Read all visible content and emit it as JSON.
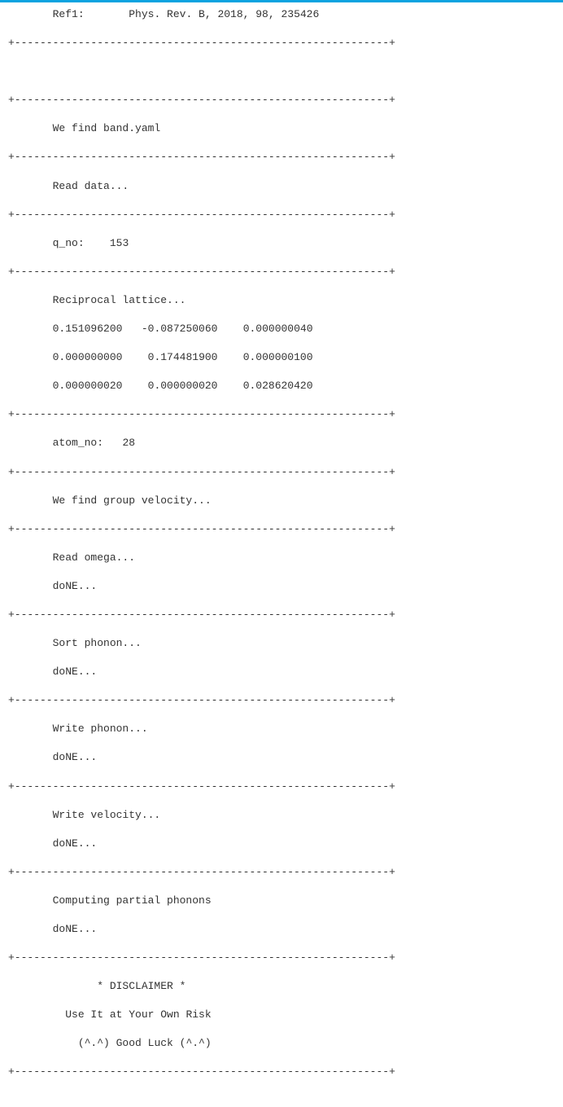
{
  "ref": {
    "label": "Ref1:",
    "citation": "Phys. Rev. B, 2018, 98, 235426"
  },
  "divider": "+-----------------------------------------------------------+",
  "sections": {
    "find_band": "We find band.yaml",
    "read_data": "Read data...",
    "q_no_label": "q_no:",
    "q_no_value": "153",
    "recip_title": "Reciprocal lattice...",
    "recip_rows": [
      [
        "0.151096200",
        "-0.087250060",
        "0.000000040"
      ],
      [
        "0.000000000",
        "0.174481900",
        "0.000000100"
      ],
      [
        "0.000000020",
        "0.000000020",
        "0.028620420"
      ]
    ],
    "atom_no_label": "atom_no:",
    "atom_no_value": "28",
    "group_vel": "We find group velocity...",
    "read_omega": "Read omega...",
    "sort_phonon": "Sort phonon...",
    "write_phonon": "Write phonon...",
    "write_velocity": "Write velocity...",
    "compute_partial": "Computing partial phonons",
    "done": "doNE..."
  },
  "footer": {
    "disclaimer_title": "* DISCLAIMER *",
    "line1": "Use It at Your Own Risk",
    "line2": "(^.^) Good Luck (^.^)"
  }
}
